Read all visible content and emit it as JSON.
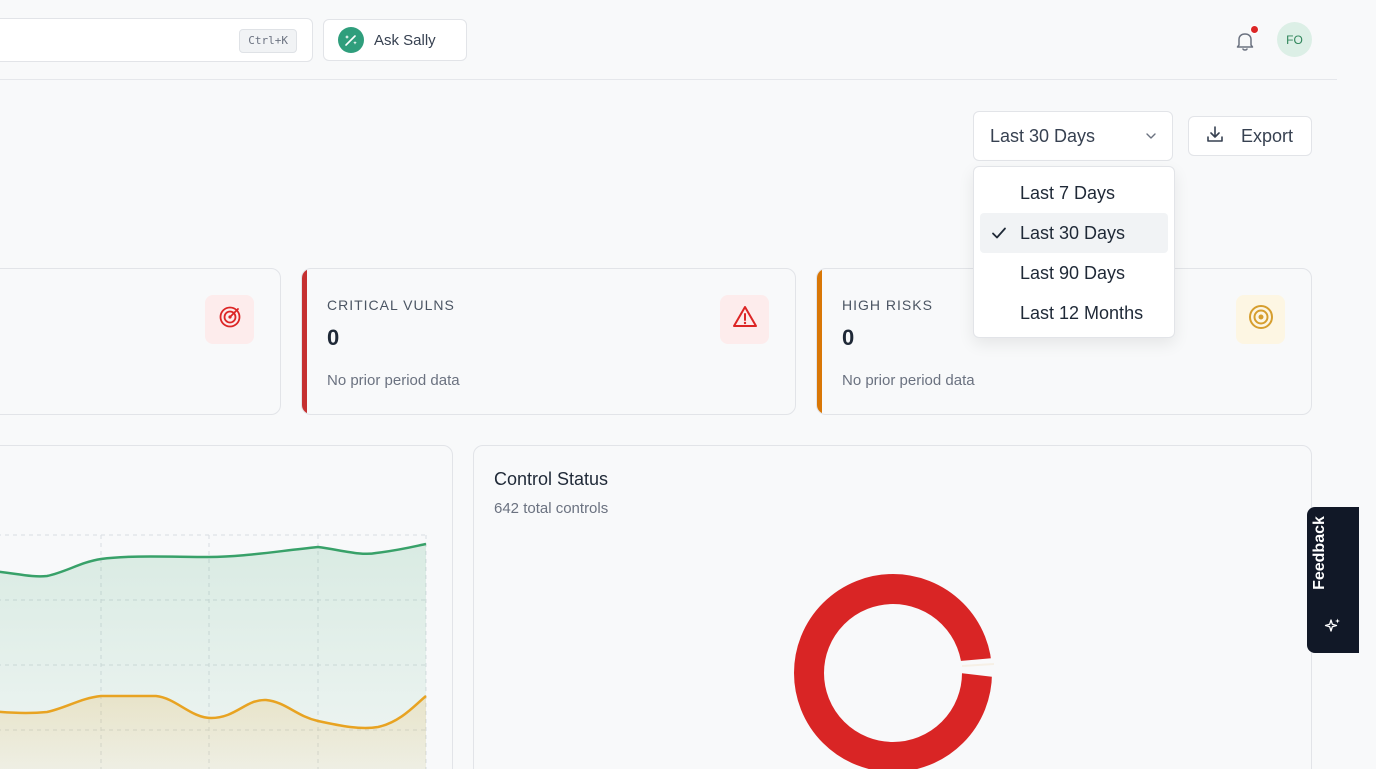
{
  "header": {
    "search_shortcut": "Ctrl+K",
    "ask_label": "Ask Sally",
    "avatar_initials": "FO"
  },
  "toolbar": {
    "period_selected": "Last 30 Days",
    "export_label": "Export"
  },
  "period_dropdown": {
    "items": [
      {
        "label": "Last 7 Days",
        "selected": false
      },
      {
        "label": "Last 30 Days",
        "selected": true
      },
      {
        "label": "Last 90 Days",
        "selected": false
      },
      {
        "label": "Last 12 Months",
        "selected": false
      }
    ]
  },
  "kpis": [
    {
      "title": "",
      "value": "",
      "sub": "",
      "accent": "",
      "icon": "radar-icon",
      "icon_color": "#dc2626",
      "icon_bg": "#fdecec"
    },
    {
      "title": "CRITICAL VULNS",
      "value": "0",
      "sub": "No prior period data",
      "accent": "#c53030",
      "icon": "alert-triangle-icon",
      "icon_color": "#dc2626",
      "icon_bg": "#fdecec"
    },
    {
      "title": "HIGH RISKS",
      "value": "0",
      "sub": "No prior period data",
      "accent": "#d97706",
      "icon": "target-icon",
      "icon_color": "#d69e2e",
      "icon_bg": "#fdf6e3"
    }
  ],
  "control_status": {
    "title": "Control Status",
    "subtitle": "642 total controls"
  },
  "trend_chart": {
    "series_colors": [
      "#38a169",
      "#e8a322"
    ]
  },
  "feedback": {
    "label": "Feedback"
  },
  "colors": {
    "accent_green": "#2f9e7c",
    "danger": "#dc2626",
    "donut": "#d92525",
    "donut_sliver": "#f6f0e6"
  }
}
